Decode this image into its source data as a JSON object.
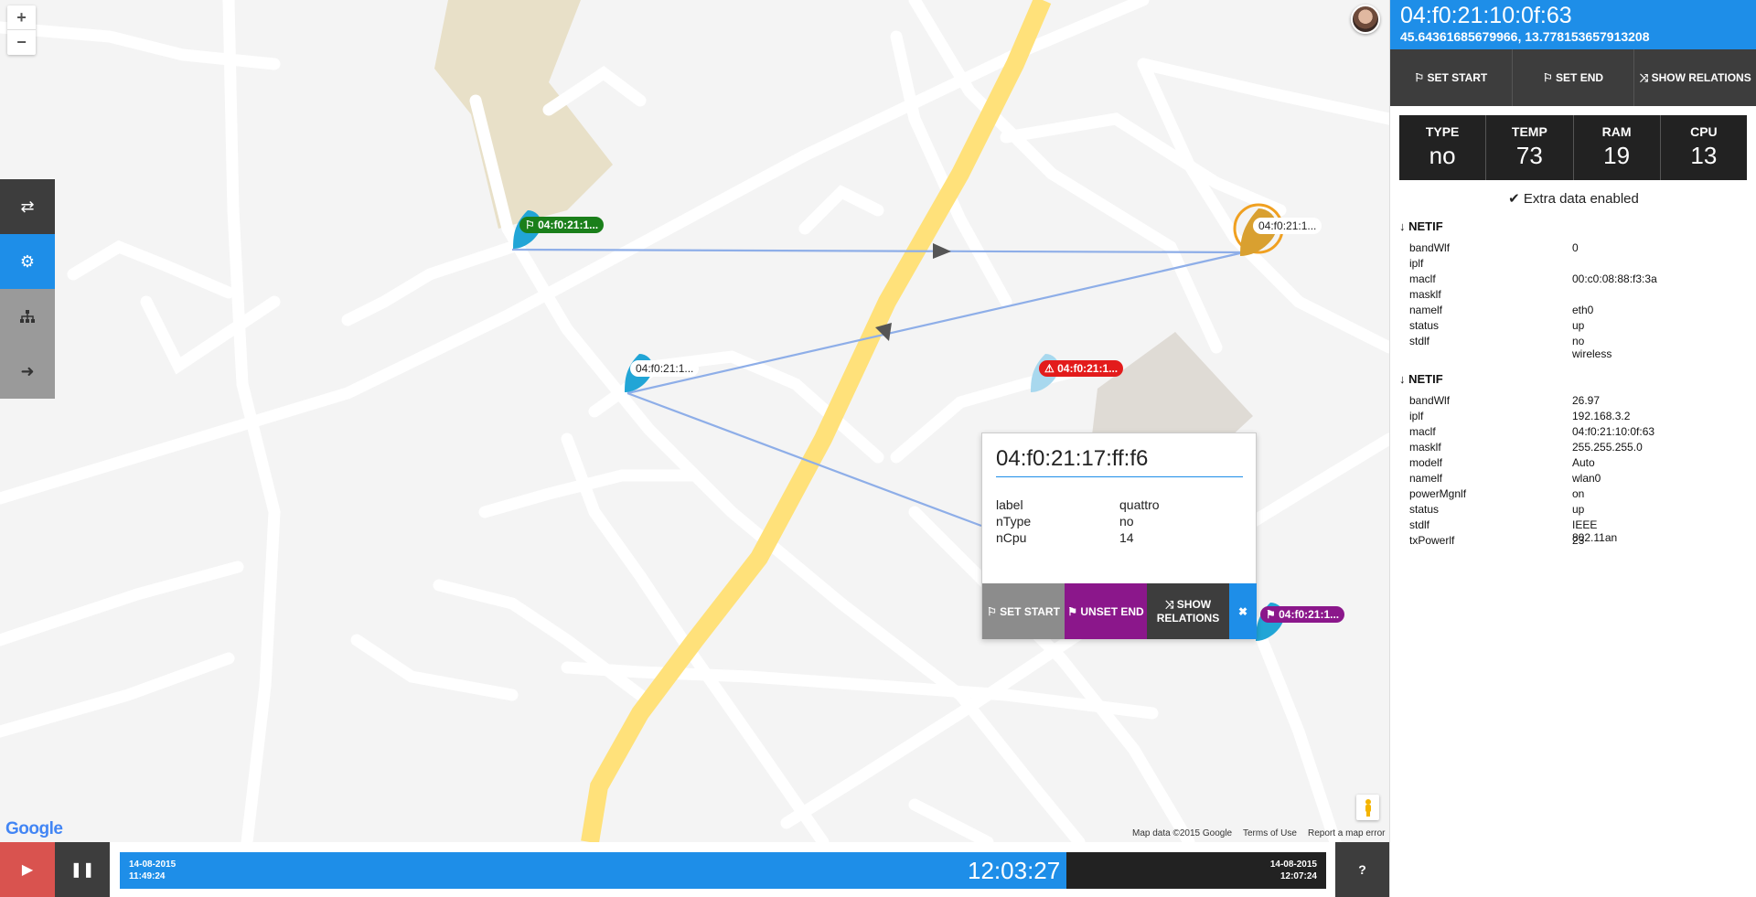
{
  "map": {
    "zoom_in": "+",
    "zoom_out": "−",
    "google_logo": "Google",
    "attribution": {
      "data": "Map data ©2015 Google",
      "terms": "Terms of Use",
      "report": "Report a map error"
    },
    "markers": [
      {
        "label": "04:f0:21:1...",
        "color": "#1a7f1a",
        "flag": "⚐"
      },
      {
        "label": "04:f0:21:1...",
        "color": "#ffffff",
        "flag": ""
      },
      {
        "label": "04:f0:21:1...",
        "color": "#ffffff",
        "flag": ""
      },
      {
        "label": "04:f0:21:1...",
        "color": "#e31b1b",
        "flag": "⚠"
      },
      {
        "label": "04:f0:21:1...",
        "color": "#8b178b",
        "flag": "⚑"
      }
    ],
    "popup": {
      "title": "04:f0:21:17:ff:f6",
      "rows": [
        {
          "key": "label",
          "value": "quattro"
        },
        {
          "key": "nType",
          "value": "no"
        },
        {
          "key": "nCpu",
          "value": "14"
        }
      ],
      "buttons": {
        "set_start": "⚐ SET START",
        "unset_end": "⚑ UNSET END",
        "show_relations": "⤨ SHOW RELATIONS",
        "close": "✖"
      }
    }
  },
  "bottom": {
    "play": "▶",
    "pause": "❚❚",
    "start_date": "14-08-2015",
    "start_time": "11:49:24",
    "current_time": "12:03:27",
    "end_date": "14-08-2015",
    "end_time": "12:07:24",
    "progress": 0.7847,
    "help": "?"
  },
  "panel": {
    "title": "04:f0:21:10:0f:63",
    "coords": "45.64361685679966, 13.778153657913208",
    "buttons": {
      "set_start": "⚐ SET START",
      "set_end": "⚐ SET END",
      "show_relations": "⤨ SHOW RELATIONS"
    },
    "stats": [
      {
        "label": "TYPE",
        "value": "no"
      },
      {
        "label": "TEMP",
        "value": "73"
      },
      {
        "label": "RAM",
        "value": "19"
      },
      {
        "label": "CPU",
        "value": "13"
      }
    ],
    "extra": "Extra data enabled",
    "netif1": {
      "header": "NETIF",
      "rows": [
        {
          "key": "bandWlf",
          "value": "0"
        },
        {
          "key": "iplf",
          "value": ""
        },
        {
          "key": "maclf",
          "value": "00:c0:08:88:f3:3a"
        },
        {
          "key": "masklf",
          "value": ""
        },
        {
          "key": "namelf",
          "value": "eth0"
        },
        {
          "key": "status",
          "value": "up"
        },
        {
          "key": "stdlf",
          "value": "no wireless"
        }
      ]
    },
    "netif2": {
      "header": "NETIF",
      "rows": [
        {
          "key": "bandWlf",
          "value": "26.97"
        },
        {
          "key": "iplf",
          "value": "192.168.3.2"
        },
        {
          "key": "maclf",
          "value": "04:f0:21:10:0f:63"
        },
        {
          "key": "masklf",
          "value": "255.255.255.0"
        },
        {
          "key": "modelf",
          "value": "Auto"
        },
        {
          "key": "namelf",
          "value": "wlan0"
        },
        {
          "key": "powerMgnlf",
          "value": "on"
        },
        {
          "key": "status",
          "value": "up"
        },
        {
          "key": "stdlf",
          "value": "IEEE 802.11an"
        },
        {
          "key": "txPowerlf",
          "value": "23"
        }
      ]
    }
  }
}
